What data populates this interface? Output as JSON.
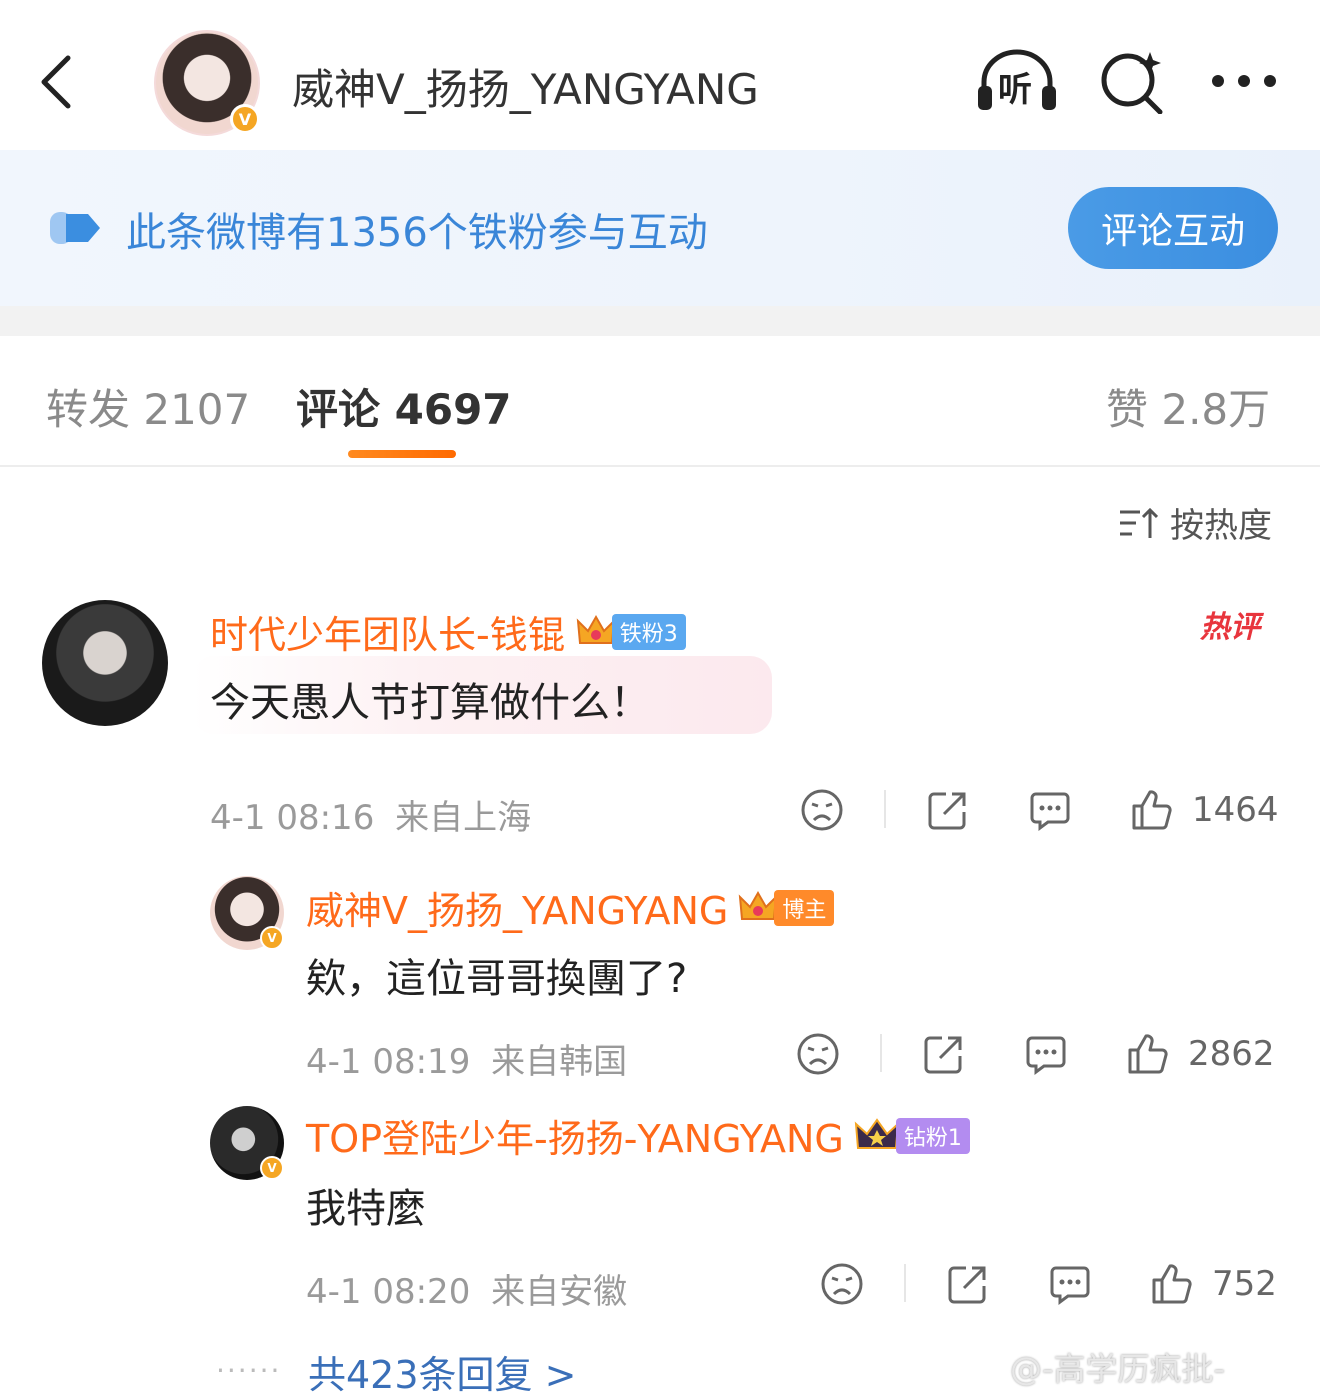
{
  "header": {
    "title": "威神V_扬扬_YANGYANG",
    "listen_label": "听",
    "icons": [
      "back-arrow-icon",
      "listen-headphone-icon",
      "search-sparkle-icon",
      "more-dots-icon"
    ]
  },
  "banner": {
    "text": "此条微博有1356个铁粉参与互动",
    "button_label": "评论互动"
  },
  "tabs": [
    {
      "label": "转发 2107",
      "active": false
    },
    {
      "label": "评论 4697",
      "active": true
    },
    {
      "label": "赞 2.8万",
      "active": false
    }
  ],
  "sort": {
    "label": "按热度"
  },
  "comments": [
    {
      "user": "时代少年团队长-钱锟",
      "tag": "铁粉3",
      "hot_badge": "热评",
      "text": "今天愚人节打算做什么！",
      "time": "4-1 08:16",
      "location": "来自上海",
      "likes": "1464"
    }
  ],
  "replies": [
    {
      "user": "威神V_扬扬_YANGYANG",
      "tag": "博主",
      "text": "欸，這位哥哥換團了?",
      "time": "4-1 08:19",
      "location": "来自韩国",
      "likes": "2862"
    },
    {
      "user": "TOP登陆少年-扬扬-YANGYANG",
      "tag": "钻粉1",
      "text": "我特麼",
      "time": "4-1 08:20",
      "location": "来自安徽",
      "likes": "752"
    }
  ],
  "more_replies": "共423条回复 >",
  "watermark": "@-高学历疯批-",
  "colors": {
    "username_orange": "#ff6a1a",
    "banner_blue": "#3a86d8",
    "tab_underline": "#ff7a10",
    "link_blue": "#3a6fb8"
  }
}
